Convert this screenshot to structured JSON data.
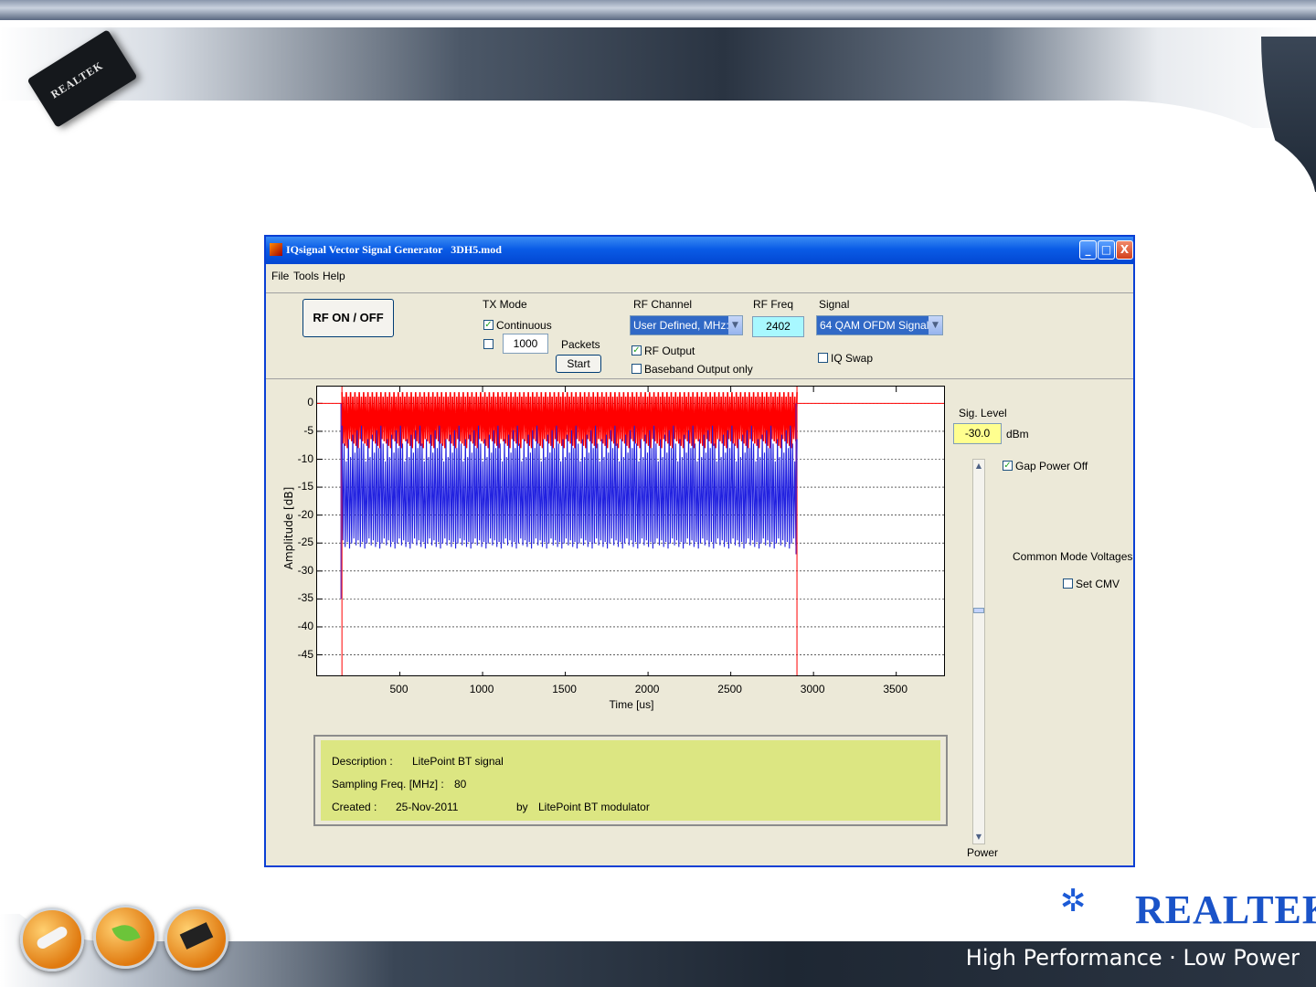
{
  "slide": {
    "chip_logo_text": "REALTEK",
    "brand_name": "REALTEK",
    "tagline": "High Performance · Low Power"
  },
  "window": {
    "title": "IQsignal Vector Signal Generator   3DH5.mod",
    "controls": {
      "minimize": "_",
      "maximize": "□",
      "close": "X"
    }
  },
  "menu": [
    "File",
    "Tools",
    "Help"
  ],
  "controls": {
    "rf_button": "RF ON / OFF",
    "tx_mode": {
      "label": "TX Mode",
      "continuous_label": "Continuous",
      "continuous_checked": true,
      "packets_checked": false,
      "packets_value": "1000",
      "packets_label": "Packets",
      "start_button": "Start"
    },
    "rf_channel": {
      "label": "RF Channel",
      "selected": "User Defined, MHz:",
      "rf_output_label": "RF Output",
      "rf_output_checked": true,
      "baseband_label": "Baseband Output only",
      "baseband_checked": false
    },
    "rf_freq": {
      "label": "RF Freq",
      "value": "2402"
    },
    "signal": {
      "label": "Signal",
      "selected": "64 QAM OFDM Signal",
      "iq_swap_label": "IQ Swap",
      "iq_swap_checked": false
    }
  },
  "side_panel": {
    "sig_level_label": "Sig. Level",
    "sig_level_value": "-30.0",
    "sig_level_unit": "dBm",
    "gap_power_off_label": "Gap Power Off",
    "gap_power_off_checked": true,
    "cmv_title": "Common Mode Voltages",
    "set_cmv_label": "Set CMV",
    "set_cmv_checked": false,
    "power_label": "Power"
  },
  "chart_data": {
    "type": "line",
    "xlabel": "Time [us]",
    "ylabel": "Amplitude [dB]",
    "xlim": [
      0,
      3800
    ],
    "ylim": [
      -49,
      3
    ],
    "x_ticks": [
      500,
      1000,
      1500,
      2000,
      2500,
      3000,
      3500
    ],
    "y_ticks": [
      0,
      -5,
      -10,
      -15,
      -20,
      -25,
      -30,
      -35,
      -40,
      -45
    ],
    "grid": "horizontal dashed",
    "burst_start_us": 150,
    "burst_end_us": 2900,
    "series": [
      {
        "name": "envelope",
        "color": "#ff0000",
        "upper_db": 2,
        "lower_db": -8
      },
      {
        "name": "samples",
        "color": "#2020e0",
        "upper_db": -4,
        "lower_db": -26
      }
    ],
    "gate_lines": {
      "color": "#ff0000",
      "x_us": [
        150,
        2900
      ],
      "level_db": -35
    }
  },
  "description": {
    "desc_label": "Description :",
    "desc_value": "LitePoint BT signal",
    "freq_label": "Sampling Freq. [MHz] :",
    "freq_value": "80",
    "created_label": "Created :",
    "created_value": "25-Nov-2011",
    "by_label": "by",
    "by_value": "LitePoint BT modulator"
  }
}
